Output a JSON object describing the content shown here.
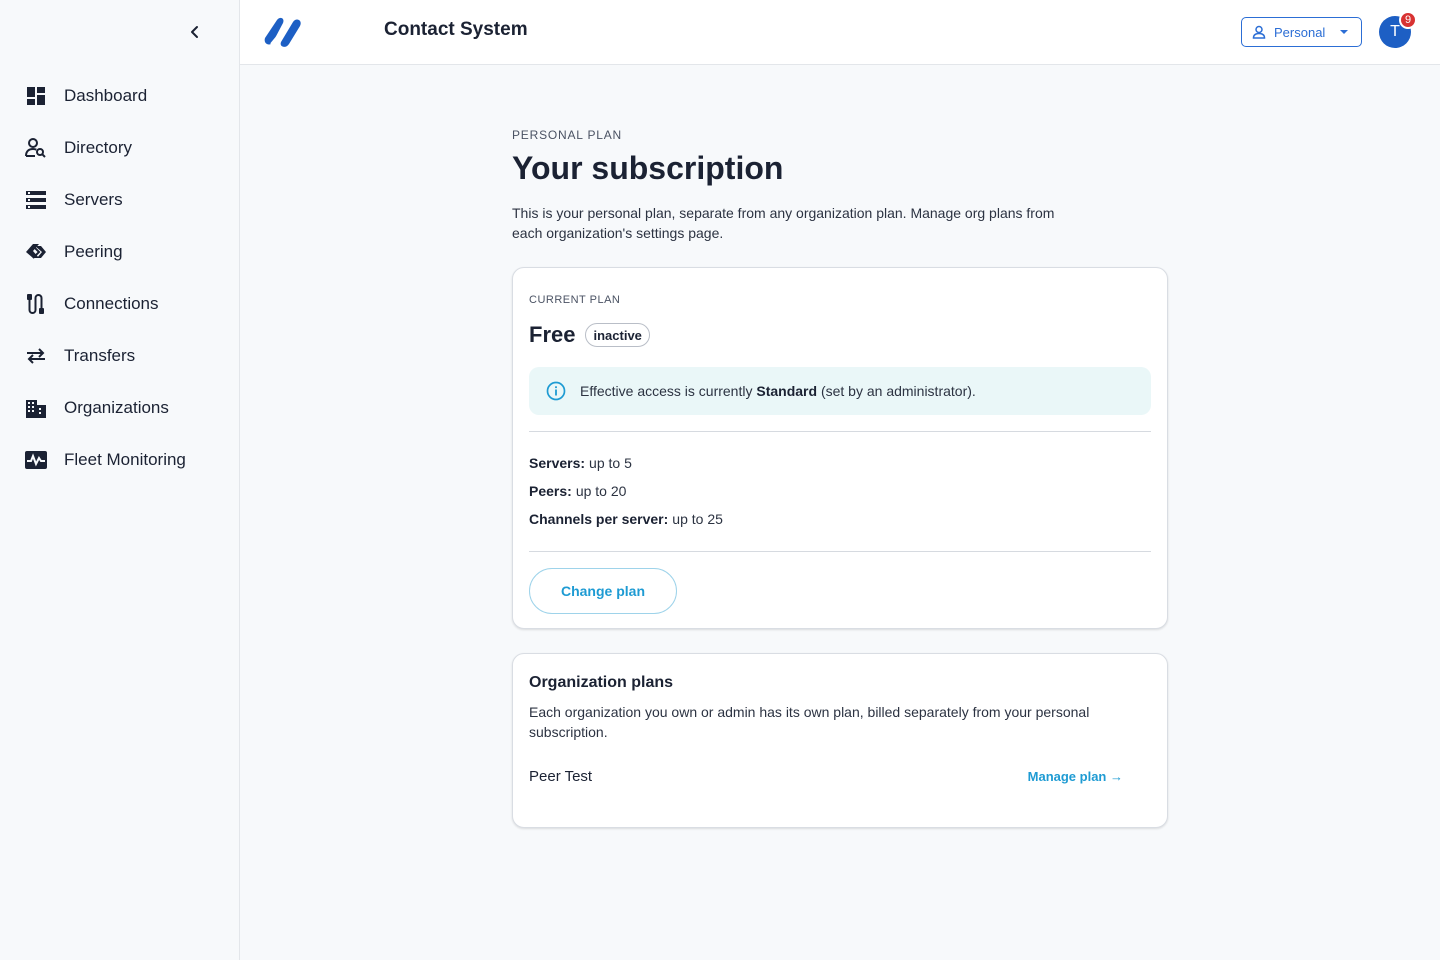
{
  "app": {
    "title": "Contact System"
  },
  "header": {
    "context_selector": {
      "label": "Personal"
    },
    "avatar": {
      "initial": "T",
      "badge_count": "9"
    }
  },
  "sidebar": {
    "items": [
      {
        "label": "Dashboard",
        "icon": "dashboard-icon"
      },
      {
        "label": "Directory",
        "icon": "person-search-icon"
      },
      {
        "label": "Servers",
        "icon": "server-list-icon"
      },
      {
        "label": "Peering",
        "icon": "peering-icon"
      },
      {
        "label": "Connections",
        "icon": "connections-icon"
      },
      {
        "label": "Transfers",
        "icon": "transfer-arrows-icon"
      },
      {
        "label": "Organizations",
        "icon": "building-icon"
      },
      {
        "label": "Fleet Monitoring",
        "icon": "monitor-pulse-icon"
      }
    ]
  },
  "main": {
    "eyebrow": "Personal plan",
    "title": "Your subscription",
    "description": "This is your personal plan, separate from any organization plan. Manage org plans from each organization's settings page.",
    "current_plan": {
      "eyebrow": "Current plan",
      "name": "Free",
      "status": "inactive",
      "info_prefix": "Effective access is currently ",
      "info_level": "Standard",
      "info_suffix": " (set by an administrator).",
      "limits": [
        {
          "label": "Servers:",
          "value": "up to 5"
        },
        {
          "label": "Peers:",
          "value": "up to 20"
        },
        {
          "label": "Channels per server:",
          "value": "up to 25"
        }
      ],
      "change_button": "Change plan"
    },
    "org_plans": {
      "title": "Organization plans",
      "description": "Each organization you own or admin has its own plan, billed separately from your personal subscription.",
      "orgs": [
        {
          "name": "Peer Test",
          "action": "Manage plan →"
        }
      ]
    }
  },
  "colors": {
    "brand": "#1d5fc4",
    "link": "#1e9bd3",
    "badge": "#d83232",
    "info_bg": "#eaf7f8"
  }
}
